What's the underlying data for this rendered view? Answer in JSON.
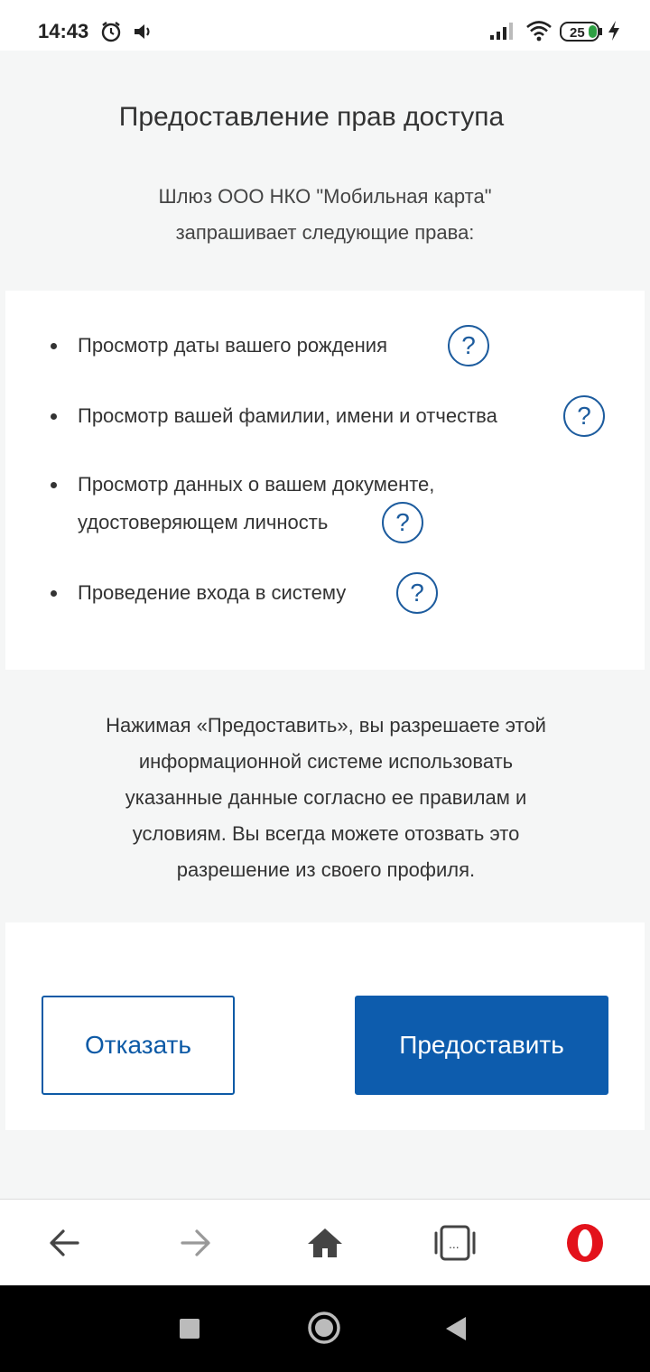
{
  "status_bar": {
    "time": "14:43",
    "battery": "25",
    "icons": [
      "alarm-icon",
      "volume-icon",
      "signal-icon",
      "wifi-icon",
      "battery-icon",
      "charging-icon"
    ]
  },
  "header": {
    "title": "Предоставление прав доступа",
    "subtitle_line1": "Шлюз ООО НКО \"Мобильная карта\"",
    "subtitle_line2": "запрашивает следующие права:"
  },
  "permissions": [
    {
      "lines": [
        "Просмотр даты вашего рождения"
      ],
      "help": "?"
    },
    {
      "lines": [
        "Просмотр вашей фамилии, имени и отчества"
      ],
      "help": "?"
    },
    {
      "lines": [
        "Просмотр данных о вашем документе,",
        "удостоверяющем личность"
      ],
      "help": "?"
    },
    {
      "lines": [
        "Проведение входа в систему"
      ],
      "help": "?"
    }
  ],
  "notice": {
    "lines": [
      "Нажимая «Предоставить», вы разрешаете этой",
      "информационной системе использовать",
      "указанные данные согласно ее правилам и",
      "условиям. Вы всегда можете отозвать это",
      "разрешение из своего профиля."
    ]
  },
  "buttons": {
    "deny_label": "Отказать",
    "grant_label": "Предоставить"
  },
  "browser_toolbar": {
    "icons": [
      "back-arrow-icon",
      "forward-arrow-icon",
      "home-icon",
      "tabs-icon",
      "opera-icon"
    ],
    "tabs_label": "..."
  },
  "android_nav": {
    "icons": [
      "recents-icon",
      "home-circle-icon",
      "back-triangle-icon"
    ]
  },
  "colors": {
    "accent": "#0d5cad",
    "help_icon": "#1d5c9e",
    "page_bg": "#f5f6f6",
    "opera_red": "#e3121b"
  }
}
